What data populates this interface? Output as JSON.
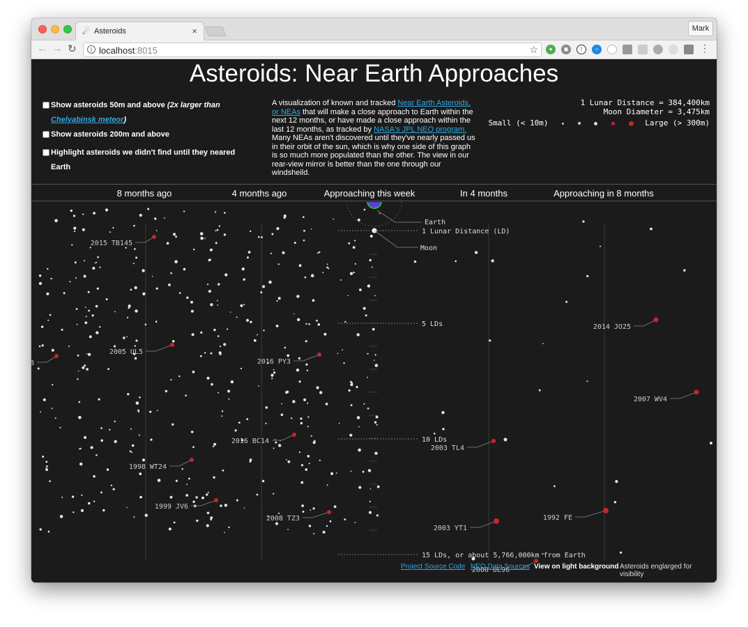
{
  "browser": {
    "tab_title": "Asteroids",
    "tab_close": "×",
    "profile": "Mark",
    "url_host": "localhost",
    "url_port": ":8015"
  },
  "page": {
    "title": "Asteroids: Near Earth Approaches",
    "options": {
      "opt1_label": "Show asteroids 50m and above",
      "opt1_italic": "(2x larger than",
      "opt1_link": "Chelyabinsk meteor",
      "opt1_tail": ")",
      "opt2_label": "Show asteroids 200m and above",
      "opt3_label": "Highlight asteroids we didn't find until they neared Earth"
    },
    "description": {
      "p1_a": "A visualization of known and tracked ",
      "p1_link1": "Near Earth Asteroids, or NEAs",
      "p1_b": " that will make a close approach to Earth within the next 12 months, or have made a close approach within the last 12 months, as tracked by ",
      "p1_link2": "NASA's JPL NEO program.",
      "p2": "Many NEAs aren't discovered until they've nearly passed us in their orbit of the sun, which is why one side of this graph is so much more populated than the other. The view in our rear-view mirror is better than the one through our windsheild."
    },
    "legend": {
      "lunar_distance": "1 Lunar Distance = 384,400km",
      "moon_diameter": "Moon Diameter = 3,475km",
      "small": "Small (< 10m)",
      "large": "Large (> 300m)"
    },
    "time_axis": [
      "8 months ago",
      "4 months ago",
      "Approaching this week",
      "In 4 months",
      "Approaching in 8 months"
    ],
    "viz": {
      "earth_label": "Earth",
      "moon_label": "Moon",
      "ld_labels": [
        "1 Lunar Distance (LD)",
        "5 LDs",
        "10 LDs",
        "15 LDs, or about 5,766,000km from Earth"
      ],
      "asteroids": [
        "2015 TB145",
        "2005 UL5",
        "2016 PY3",
        "2016 BC14",
        "1998 WT24",
        "1999 JV6",
        "2008 TZ3",
        "2014 JO25",
        "2007 WV4",
        "2003 TL4",
        "2003 YT1",
        "1992 FE",
        "2000 UL96",
        "8"
      ]
    },
    "footer": {
      "source_code": "Project Source Code",
      "data_sources": "NEO Data Sources",
      "light_bg": "View on light background",
      "enlarged": "Asteroids englarged for visibility"
    }
  },
  "colors": {
    "background": "#1b1b1b",
    "link": "#2fa9e1",
    "hazard": "#c4262b",
    "asteroid": "#e6e6e6",
    "earth": "#5a3fd6",
    "earth_ring": "#2ab04a"
  },
  "icons": [
    "asteroid-favicon",
    "info-icon",
    "star-icon",
    "back-icon",
    "forward-icon",
    "reload-icon",
    "menu-icon"
  ]
}
